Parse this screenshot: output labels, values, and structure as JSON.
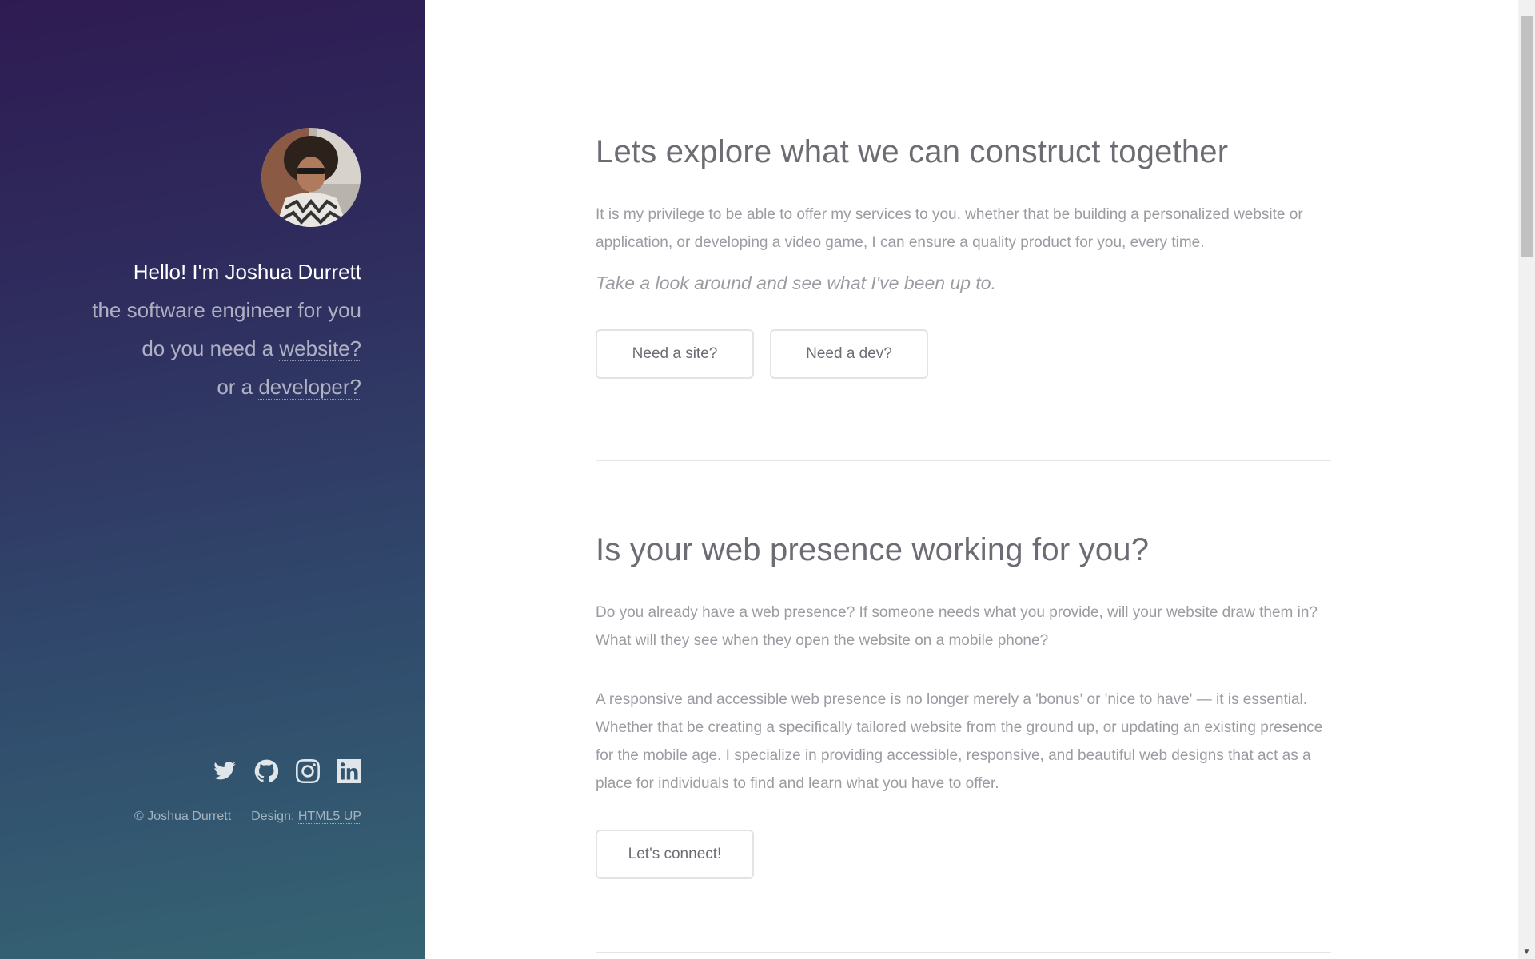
{
  "sidebar": {
    "avatar_alt": "Profile photo",
    "greeting": "Hello! I'm Joshua Durrett",
    "tagline": "the software engineer for you",
    "line3_prefix": "do you need a ",
    "website_link": "website?",
    "line4_prefix": "or a ",
    "developer_link": "developer?",
    "social": [
      {
        "icon": "twitter-icon",
        "label": "Twitter"
      },
      {
        "icon": "github-icon",
        "label": "GitHub"
      },
      {
        "icon": "instagram-icon",
        "label": "Instagram"
      },
      {
        "icon": "linkedin-icon",
        "label": "LinkedIn"
      }
    ],
    "copyright": "© Joshua Durrett",
    "design_prefix": "Design: ",
    "design_link": "HTML5 UP"
  },
  "main": {
    "section1": {
      "heading": "Lets explore what we can construct together",
      "body": "It is my privilege to be able to offer my services to you. whether that be building a personalized website or application, or developing a video game, I can ensure a quality product for you, every time.",
      "italic": "Take a look around and see what I've been up to.",
      "button_site": "Need a site?",
      "button_dev": "Need a dev?"
    },
    "section2": {
      "heading": "Is your web presence working for you?",
      "para1": "Do you already have a web presence? If someone needs what you provide, will your website draw them in? What will they see when they open the website on a mobile phone?",
      "para2": "A responsive and accessible web presence is no longer merely a 'bonus' or 'nice to have' — it is essential. Whether that be creating a specifically tailored website from the ground up, or updating an existing presence for the mobile age. I specialize in providing accessible, responsive, and beautiful web designs that act as a place for individuals to find and learn what you have to offer.",
      "button_connect": "Let's connect!"
    }
  },
  "colors": {
    "sidebar_top": "#2e1b52",
    "sidebar_bottom": "#356473",
    "heading": "#6c6c74",
    "body_text": "#9b9ba2"
  }
}
